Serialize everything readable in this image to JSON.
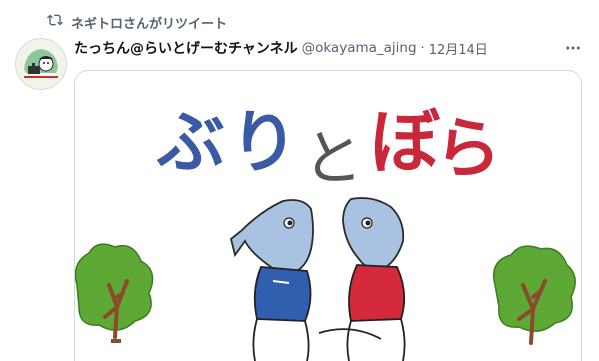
{
  "retweet": {
    "text": "ネギトロさんがリツイート",
    "icon": "retweet-icon"
  },
  "tweet": {
    "display_name": "たっちん@らいとげーむチャンネル",
    "handle": "@okayama_ajing",
    "separator": "·",
    "time": "12月14日",
    "more_icon": "more-icon"
  },
  "media": {
    "title_chars": [
      "ぶ",
      "り",
      "と",
      "ぼ",
      "ら"
    ],
    "title_colors": {
      "buri": "#3b5aa6",
      "to": "#555555",
      "bora": "#c8283a"
    },
    "tree_colors": {
      "leaf": "#5ea935",
      "trunk": "#8a4a2c"
    }
  }
}
